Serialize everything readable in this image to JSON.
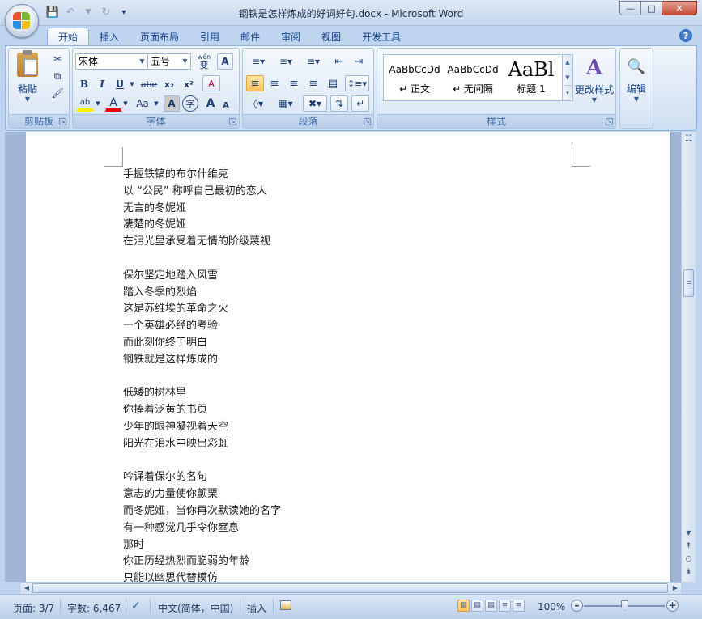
{
  "window": {
    "title": "钢铁是怎样炼成的好词好句.docx - Microsoft Word",
    "qat_icons": [
      "save-icon",
      "undo-icon",
      "redo-icon",
      "customize-qat-icon"
    ]
  },
  "tabs": [
    "开始",
    "插入",
    "页面布局",
    "引用",
    "邮件",
    "审阅",
    "视图",
    "开发工具"
  ],
  "active_tab": "开始",
  "ribbon": {
    "clipboard": {
      "label": "剪贴板",
      "paste": "粘贴"
    },
    "font": {
      "label": "字体",
      "font_name": "宋体",
      "font_size": "五号",
      "wen": "wén",
      "wen_char": "变",
      "a_box": "A",
      "bold": "B",
      "italic": "I",
      "underline": "U",
      "strike": "abe",
      "subscript": "x₂",
      "superscript": "x²",
      "clear": "A",
      "highlight": "ab",
      "font_color": "A",
      "change_case": "Aa",
      "char_shading": "A",
      "enclose": "字",
      "grow": "A",
      "shrink": "A"
    },
    "paragraph": {
      "label": "段落"
    },
    "styles": {
      "label": "样式",
      "items": [
        {
          "sample": "AaBbCcDd",
          "name": "↵ 正文"
        },
        {
          "sample": "AaBbCcDd",
          "name": "↵ 无间隔"
        },
        {
          "sample": "AaBl",
          "name": "标题 1"
        }
      ],
      "change_styles": "更改样式"
    },
    "editing": {
      "label": "编辑"
    }
  },
  "document": {
    "lines": [
      "手握铁镐的布尔什维克",
      "以 “公民” 称呼自己最初的恋人",
      "无言的冬妮娅",
      "凄楚的冬妮娅",
      "在泪光里承受着无情的阶级蔑视",
      "",
      "保尔坚定地踏入风雪",
      "踏入冬季的烈焰",
      "这是苏维埃的革命之火",
      "一个英雄必经的考验",
      "而此刻你终于明白",
      "钢铁就是这样炼成的",
      "",
      "低矮的树林里",
      "你捧着泛黄的书页",
      "少年的眼神凝视着天空",
      "阳光在泪水中映出彩虹",
      "",
      "吟诵着保尔的名句",
      "意志的力量使你颤栗",
      "而冬妮娅，当你再次默读她的名字",
      "有一种感觉几乎令你窒息",
      "那时",
      "你正历经热烈而脆弱的年龄",
      "只能以幽思代替模仿"
    ]
  },
  "status": {
    "page": "页面: 3/7",
    "words": "字数: 6,467",
    "language": "中文(简体，中国)",
    "mode": "插入",
    "zoom": "100%",
    "zoom_level": 1.0
  }
}
